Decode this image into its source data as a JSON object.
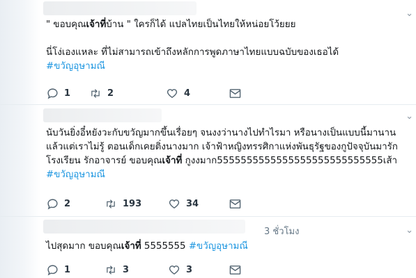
{
  "tweets": [
    {
      "time": "",
      "lines": [
        [
          "\" ขอบคุณ",
          "เจ้าที่",
          "บ้าน \" ใครก็ได้ แปลไทยเป็นไทยให้หน่อยโว้ยยย"
        ],
        [
          ""
        ],
        [
          "นี่โง่เองแหละ ที่ไม่สามารถเข้าถึงหลักการพูดภาษาไทยแบบฉบับของเธอได้"
        ]
      ],
      "hashtag": "#ขวัญอุษามณี",
      "counts": {
        "reply": "1",
        "retweet": "2",
        "like": "4"
      }
    },
    {
      "time": "",
      "lines": [
        [
          "นับวันยิ่งอี๋หยังวะกับขวัญมากขึ้นเรื่อยๆ จนงงว่านางไปทำไรมา หรือนางเป็นแบบนี้มานาน"
        ],
        [
          "แล้วแต่เราไม่รู้ ตอนเด็กเคยติ่งนางมาก เจ้าฟ้าหญิงทรรศิกาแห่งพันธุรัฐของกูปัจจุบันมารัก"
        ],
        [
          "โรงเรียน รักอาจารย์ ขอบคุณ",
          "เจ้าที่",
          " กูงงมาก5555555555555555555555555555เส้า"
        ]
      ],
      "hashtag": "#ขวัญอุษามณี",
      "counts": {
        "reply": "2",
        "retweet": "193",
        "like": "34"
      }
    },
    {
      "time": "3 ชั่วโมง",
      "lines": [
        [
          "ไปสุดมาก ขอบคุณ",
          "เจ้าที่",
          " 5555555 "
        ]
      ],
      "hashtag_inline": "#ขวัญอุษามณี",
      "counts": {
        "reply": "1",
        "retweet": "3",
        "like": "3"
      }
    }
  ],
  "icons": {
    "reply": "reply-icon",
    "retweet": "retweet-icon",
    "like": "heart-icon",
    "dm": "envelope-icon",
    "menu": "chevron-down-icon"
  },
  "colors": {
    "hashtag": "#1b95e0",
    "icon": "#536471",
    "divider": "#e6ecf0"
  }
}
